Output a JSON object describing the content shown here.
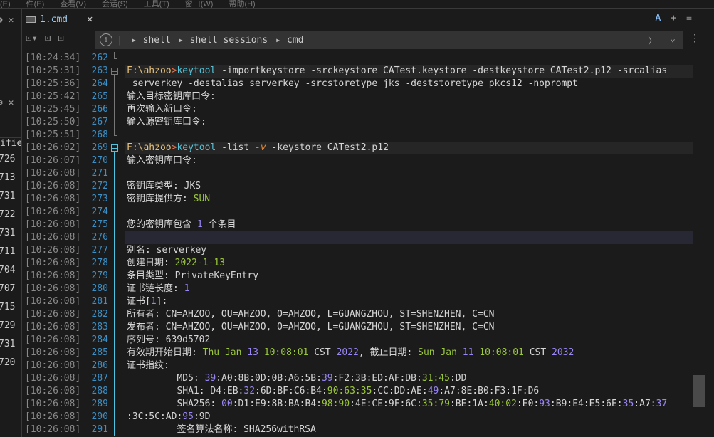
{
  "menu": [
    "(E)",
    "件(E)",
    "查看(V)",
    "会话(S)",
    "工具(T)",
    "窗口(W)",
    "帮助(H)"
  ],
  "left_panel": {
    "header": "ifie",
    "rows": [
      [
        "726",
        "1"
      ],
      [
        "713",
        "1"
      ],
      [
        "731",
        "0"
      ],
      [
        "722",
        "1"
      ],
      [
        "731",
        "0"
      ],
      [
        "711",
        "1"
      ],
      [
        "704",
        "1"
      ],
      [
        "707",
        "2"
      ],
      [
        "715",
        "1"
      ],
      [
        "729",
        "1"
      ],
      [
        "731",
        "0"
      ],
      [
        "720",
        "1"
      ]
    ]
  },
  "tab": {
    "label": "1.cmd",
    "close": "✕",
    "icon": "terminal-icon"
  },
  "tab_actions": {
    "font": "A",
    "add": "+",
    "menu": "≡"
  },
  "breadcrumb": [
    "shell",
    "shell sessions",
    "cmd"
  ],
  "colors": {
    "prompt": "#e5c07b",
    "command": "#56c4d8",
    "number": "#9a86f5",
    "date": "#9bc83b",
    "line_number": "#3d8fc5"
  },
  "lines": [
    {
      "ts": "[10:24:34]",
      "n": "262",
      "fold": "end",
      "segs": []
    },
    {
      "ts": "[10:25:31]",
      "n": "263",
      "fold": "start",
      "hl": 1,
      "segs": [
        [
          "F:\\ahzoo",
          "y"
        ],
        [
          ">",
          "o"
        ],
        [
          "keytool",
          "c"
        ],
        [
          " -importkeystore -srckeystore CATest.keystore -destkeystore CATest2.p12 -srcalias",
          "w"
        ]
      ]
    },
    {
      "ts": "[10:25:36]",
      "n": "264",
      "fold": "mid",
      "segs": [
        [
          " serverkey -destalias serverkey -srcstoretype jks -deststoretype pkcs12 -noprompt",
          "w"
        ]
      ]
    },
    {
      "ts": "[10:25:42]",
      "n": "265",
      "fold": "mid",
      "segs": [
        [
          "输入目标密钥库口令:",
          "w"
        ]
      ]
    },
    {
      "ts": "[10:25:45]",
      "n": "266",
      "fold": "mid",
      "segs": [
        [
          "再次输入新口令:",
          "w"
        ]
      ]
    },
    {
      "ts": "[10:25:50]",
      "n": "267",
      "fold": "mid",
      "segs": [
        [
          "输入源密钥库口令:",
          "w"
        ]
      ]
    },
    {
      "ts": "[10:25:51]",
      "n": "268",
      "fold": "end",
      "segs": []
    },
    {
      "ts": "[10:26:02]",
      "n": "269",
      "fold": "start2",
      "hl": 1,
      "segs": [
        [
          "F:\\ahzoo",
          "y"
        ],
        [
          ">",
          "o"
        ],
        [
          "keytool",
          "c"
        ],
        [
          " -list ",
          "w"
        ],
        [
          "-v",
          "v"
        ],
        [
          " -keystore CATest2.p12",
          "w"
        ]
      ]
    },
    {
      "ts": "[10:26:07]",
      "n": "270",
      "fold": "mid2",
      "segs": [
        [
          "输入密钥库口令:",
          "w"
        ]
      ]
    },
    {
      "ts": "[10:26:08]",
      "n": "271",
      "fold": "mid2",
      "segs": []
    },
    {
      "ts": "[10:26:08]",
      "n": "272",
      "fold": "mid2",
      "segs": [
        [
          "密钥库类型: JKS",
          "w"
        ]
      ]
    },
    {
      "ts": "[10:26:08]",
      "n": "273",
      "fold": "mid2",
      "segs": [
        [
          "密钥库提供方: ",
          "w"
        ],
        [
          "SUN",
          "g"
        ]
      ]
    },
    {
      "ts": "[10:26:08]",
      "n": "274",
      "fold": "mid2",
      "segs": []
    },
    {
      "ts": "[10:26:08]",
      "n": "275",
      "fold": "mid2",
      "segs": [
        [
          "您的密钥库包含 ",
          "w"
        ],
        [
          "1",
          "p"
        ],
        [
          " 个条目",
          "w"
        ]
      ]
    },
    {
      "ts": "[10:26:08]",
      "n": "276",
      "fold": "mid2",
      "hl": 2,
      "segs": []
    },
    {
      "ts": "[10:26:08]",
      "n": "277",
      "fold": "mid2",
      "segs": [
        [
          "别名: serverkey",
          "w"
        ]
      ]
    },
    {
      "ts": "[10:26:08]",
      "n": "278",
      "fold": "mid2",
      "segs": [
        [
          "创建日期: ",
          "w"
        ],
        [
          "2022-1-13",
          "g"
        ]
      ]
    },
    {
      "ts": "[10:26:08]",
      "n": "279",
      "fold": "mid2",
      "segs": [
        [
          "条目类型: PrivateKeyEntry",
          "w"
        ]
      ]
    },
    {
      "ts": "[10:26:08]",
      "n": "280",
      "fold": "mid2",
      "segs": [
        [
          "证书链长度: ",
          "w"
        ],
        [
          "1",
          "p"
        ]
      ]
    },
    {
      "ts": "[10:26:08]",
      "n": "281",
      "fold": "mid2",
      "segs": [
        [
          "证书[",
          "w"
        ],
        [
          "1",
          "p"
        ],
        [
          "]:",
          "w"
        ]
      ]
    },
    {
      "ts": "[10:26:08]",
      "n": "282",
      "fold": "mid2",
      "segs": [
        [
          "所有者: CN=AHZOO, OU=AHZOO, O=AHZOO, L=GUANGZHOU, ST=SHENZHEN, C=CN",
          "w"
        ]
      ]
    },
    {
      "ts": "[10:26:08]",
      "n": "283",
      "fold": "mid2",
      "segs": [
        [
          "发布者: CN=AHZOO, OU=AHZOO, O=AHZOO, L=GUANGZHOU, ST=SHENZHEN, C=CN",
          "w"
        ]
      ]
    },
    {
      "ts": "[10:26:08]",
      "n": "284",
      "fold": "mid2",
      "segs": [
        [
          "序列号: 639d5702",
          "w"
        ]
      ]
    },
    {
      "ts": "[10:26:08]",
      "n": "285",
      "fold": "mid2",
      "segs": [
        [
          "有效期开始日期: ",
          "w"
        ],
        [
          "Thu Jan ",
          "g"
        ],
        [
          "13",
          "p"
        ],
        [
          " 10:08:01",
          "g"
        ],
        [
          " CST ",
          "w"
        ],
        [
          "2022",
          "p"
        ],
        [
          ", 截止日期: ",
          "w"
        ],
        [
          "Sun Jan ",
          "g"
        ],
        [
          "11",
          "p"
        ],
        [
          " 10:08:01",
          "g"
        ],
        [
          " CST ",
          "w"
        ],
        [
          "2032",
          "p"
        ]
      ]
    },
    {
      "ts": "[10:26:08]",
      "n": "286",
      "fold": "mid2",
      "segs": [
        [
          "证书指纹:",
          "w"
        ]
      ]
    },
    {
      "ts": "[10:26:08]",
      "n": "287",
      "fold": "mid2",
      "segs": [
        [
          "         MD5: ",
          "w"
        ],
        [
          "39",
          "p"
        ],
        [
          ":A0:8B:0D:0B:A6:5B:",
          "w"
        ],
        [
          "39",
          "p"
        ],
        [
          ":F2:3B:ED:AF:DB:",
          "w"
        ],
        [
          "31:45",
          "g"
        ],
        [
          ":DD",
          "w"
        ]
      ]
    },
    {
      "ts": "[10:26:08]",
      "n": "288",
      "fold": "mid2",
      "segs": [
        [
          "         SHA1: D4:EB:",
          "w"
        ],
        [
          "32",
          "p"
        ],
        [
          ":6D:BF:C6:B4:",
          "w"
        ],
        [
          "90:63:35",
          "g"
        ],
        [
          ":CC:DD:AE:",
          "w"
        ],
        [
          "49",
          "p"
        ],
        [
          ":A7:8E:B0:F3:1F:D6",
          "w"
        ]
      ]
    },
    {
      "ts": "[10:26:08]",
      "n": "289",
      "fold": "mid2",
      "segs": [
        [
          "         SHA256: ",
          "w"
        ],
        [
          "00",
          "p"
        ],
        [
          ":D1:E9:8B:BA:B4:",
          "w"
        ],
        [
          "98:90",
          "g"
        ],
        [
          ":4E:CE:9F:6C:",
          "w"
        ],
        [
          "35:79",
          "g"
        ],
        [
          ":BE:1A:",
          "w"
        ],
        [
          "40:02",
          "g"
        ],
        [
          ":E0:",
          "w"
        ],
        [
          "93",
          "p"
        ],
        [
          ":B9:E4:E5:6E:",
          "w"
        ],
        [
          "35",
          "p"
        ],
        [
          ":A7:",
          "w"
        ],
        [
          "37",
          "p"
        ]
      ]
    },
    {
      "ts": "[10:26:08]",
      "n": "290",
      "fold": "mid2",
      "segs": [
        [
          ":3C:5C:AD:",
          "w"
        ],
        [
          "95",
          "p"
        ],
        [
          ":9D",
          "w"
        ]
      ]
    },
    {
      "ts": "[10:26:08]",
      "n": "291",
      "fold": "mid2",
      "segs": [
        [
          "         签名算法名称: SHA256withRSA",
          "w"
        ]
      ]
    }
  ]
}
